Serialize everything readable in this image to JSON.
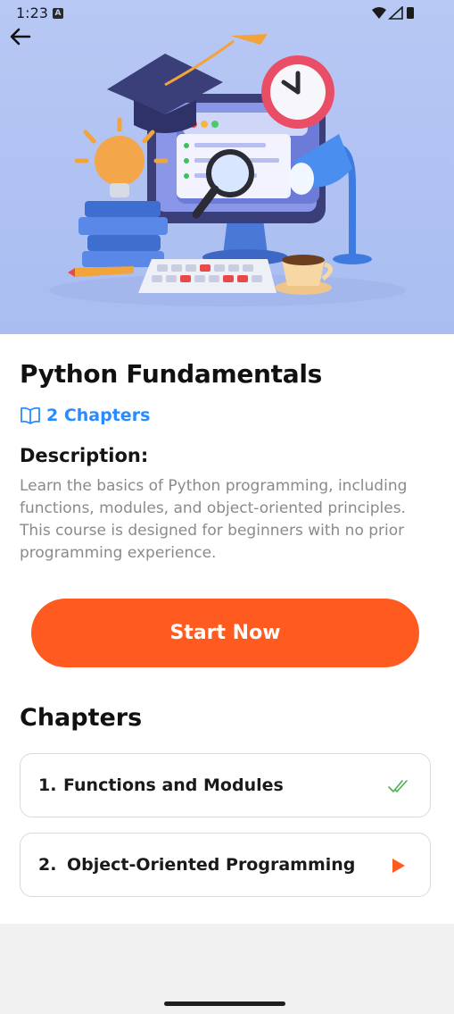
{
  "status_bar": {
    "time": "1:23",
    "notification_icon": "a-badge-icon",
    "icons": [
      "wifi-icon",
      "signal-icon",
      "battery-icon"
    ]
  },
  "header": {
    "back_icon": "arrow-left-icon",
    "hero_image": "course-illustration"
  },
  "course": {
    "title": "Python Fundamentals",
    "chapter_count_icon": "book-icon",
    "chapter_count": "2 Chapters",
    "description_heading": "Description:",
    "description": "Learn the basics of Python programming, including functions, modules, and object-oriented principles. This course is designed for beginners with no prior programming experience.",
    "start_button": "Start Now"
  },
  "chapters": {
    "heading": "Chapters",
    "items": [
      {
        "number": "1.",
        "title": "Functions and Modules",
        "status_icon": "double-check-icon"
      },
      {
        "number": "2.",
        "title": "Object-Oriented Programming",
        "status_icon": "play-icon"
      }
    ]
  },
  "colors": {
    "accent": "#ff5a1f",
    "link": "#2a8bff",
    "completed": "#4caf50",
    "hero_bg": "#b3c5f3"
  }
}
